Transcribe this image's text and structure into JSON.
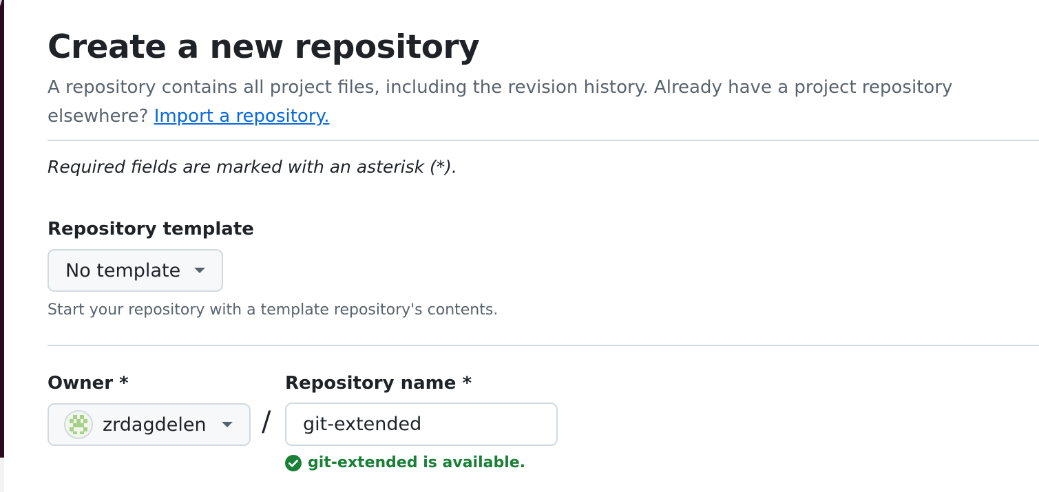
{
  "header": {
    "title": "Create a new repository",
    "subtitle_text": "A repository contains all project files, including the revision history. Already have a project repository elsewhere?",
    "import_link_label": "Import a repository."
  },
  "required_note": "Required fields are marked with an asterisk (*).",
  "template": {
    "label": "Repository template",
    "selected": "No template",
    "hint": "Start your repository with a template repository's contents."
  },
  "owner": {
    "label": "Owner *",
    "selected": "zrdagdelen",
    "avatar_icon": "identicon-avatar"
  },
  "separator": "/",
  "repo_name": {
    "label": "Repository name *",
    "value": "git-extended",
    "availability": "git-extended is available.",
    "availability_icon": "check-circle-icon"
  },
  "colors": {
    "link": "#0969da",
    "success": "#1a7f37",
    "muted_text": "#59636e",
    "border": "#d1d9e0",
    "button_bg": "#f6f8fa",
    "side_strip": "#2c0a1f"
  }
}
